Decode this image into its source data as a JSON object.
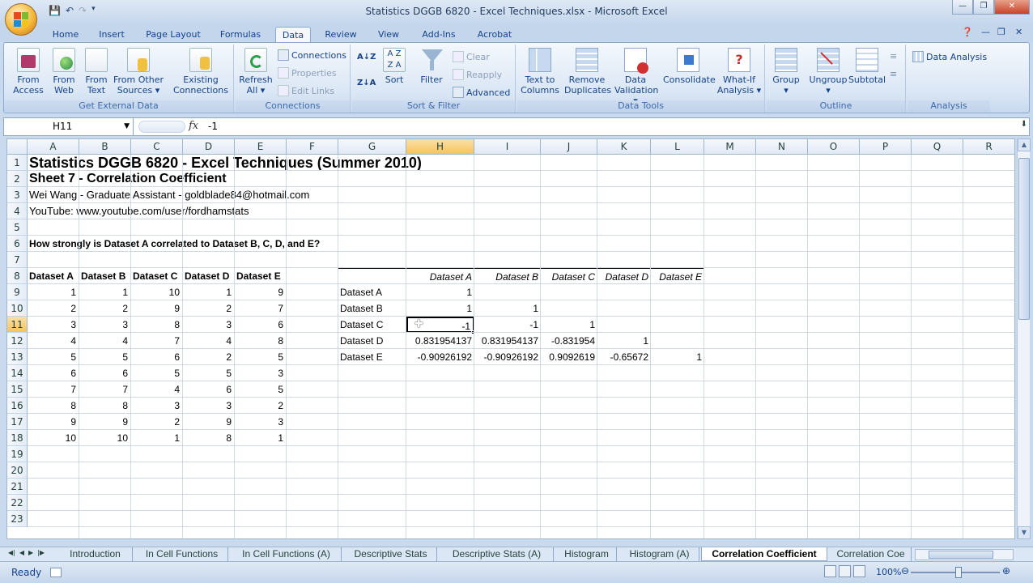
{
  "window": {
    "title": "Statistics DGGB 6820 - Excel Techniques.xlsx - Microsoft Excel"
  },
  "ribbon_tabs": [
    "Home",
    "Insert",
    "Page Layout",
    "Formulas",
    "Data",
    "Review",
    "View",
    "Add-Ins",
    "Acrobat"
  ],
  "active_tab": "Data",
  "groups": {
    "external": {
      "label": "Get External Data",
      "from_access": "From Access",
      "from_web": "From Web",
      "from_text": "From Text",
      "from_other": "From Other Sources",
      "existing": "Existing Connections"
    },
    "connections": {
      "label": "Connections",
      "refresh": "Refresh All",
      "connections": "Connections",
      "properties": "Properties",
      "edit_links": "Edit Links"
    },
    "sortfilter": {
      "label": "Sort & Filter",
      "sort": "Sort",
      "filter": "Filter",
      "clear": "Clear",
      "reapply": "Reapply",
      "advanced": "Advanced",
      "az": "A↓Z",
      "za": "Z↓A"
    },
    "datatools": {
      "label": "Data Tools",
      "text_to_columns": "Text to Columns",
      "remove_duplicates": "Remove Duplicates",
      "data_validation": "Data Validation",
      "consolidate": "Consolidate",
      "what_if": "What-If Analysis"
    },
    "outline": {
      "label": "Outline",
      "group": "Group",
      "ungroup": "Ungroup",
      "subtotal": "Subtotal"
    },
    "analysis": {
      "label": "Analysis",
      "data_analysis": "Data Analysis"
    }
  },
  "formula_bar": {
    "name_box": "H11",
    "fx": "fx",
    "value": "-1"
  },
  "columns": [
    "A",
    "B",
    "C",
    "D",
    "E",
    "F",
    "G",
    "H",
    "I",
    "J",
    "K",
    "L",
    "M",
    "N",
    "O",
    "P",
    "Q",
    "R"
  ],
  "rows": [
    "1",
    "2",
    "3",
    "4",
    "5",
    "6",
    "7",
    "8",
    "9",
    "10",
    "11",
    "12",
    "13",
    "14",
    "15",
    "16",
    "17",
    "18",
    "19",
    "20",
    "21",
    "22",
    "23"
  ],
  "sheet": {
    "title1": "Statistics DGGB 6820 - Excel Techniques (Summer 2010)",
    "title2": "Sheet 7 - Correlation Coefficient",
    "author": "Wei Wang - Graduate Assistant - goldblade84@hotmail.com",
    "youtube": "YouTube: www.youtube.com/user/fordhamstats",
    "question": "How strongly is Dataset A correlated to Dataset B, C, D, and E?",
    "dataset_headers": [
      "Dataset A",
      "Dataset B",
      "Dataset C",
      "Dataset D",
      "Dataset E"
    ],
    "dataset_values": [
      [
        "1",
        "1",
        "10",
        "1",
        "9"
      ],
      [
        "2",
        "2",
        "9",
        "2",
        "7"
      ],
      [
        "3",
        "3",
        "8",
        "3",
        "6"
      ],
      [
        "4",
        "4",
        "7",
        "4",
        "8"
      ],
      [
        "5",
        "5",
        "6",
        "2",
        "5"
      ],
      [
        "6",
        "6",
        "5",
        "5",
        "3"
      ],
      [
        "7",
        "7",
        "4",
        "6",
        "5"
      ],
      [
        "8",
        "8",
        "3",
        "3",
        "2"
      ],
      [
        "9",
        "9",
        "2",
        "9",
        "3"
      ],
      [
        "10",
        "10",
        "1",
        "8",
        "1"
      ]
    ],
    "matrix_col_headers": [
      "Dataset A",
      "Dataset B",
      "Dataset C",
      "Dataset D",
      "Dataset E"
    ],
    "matrix_row_headers": [
      "Dataset A",
      "Dataset B",
      "Dataset C",
      "Dataset D",
      "Dataset E"
    ],
    "matrix": [
      [
        "1",
        "",
        "",
        "",
        ""
      ],
      [
        "1",
        "1",
        "",
        "",
        ""
      ],
      [
        "-1",
        "-1",
        "1",
        "",
        ""
      ],
      [
        "0.831954137",
        "0.831954137",
        "-0.831954",
        "1",
        ""
      ],
      [
        "-0.90926192",
        "-0.90926192",
        "0.9092619",
        "-0.65672",
        "1"
      ]
    ]
  },
  "sheet_tabs": [
    "Introduction",
    "In Cell Functions",
    "In Cell Functions (A)",
    "Descriptive Stats",
    "Descriptive Stats (A)",
    "Histogram",
    "Histogram (A)",
    "Correlation Coefficient",
    "Correlation Coe"
  ],
  "active_sheet": "Correlation Coefficient",
  "status": {
    "ready": "Ready",
    "zoom": "100%"
  }
}
